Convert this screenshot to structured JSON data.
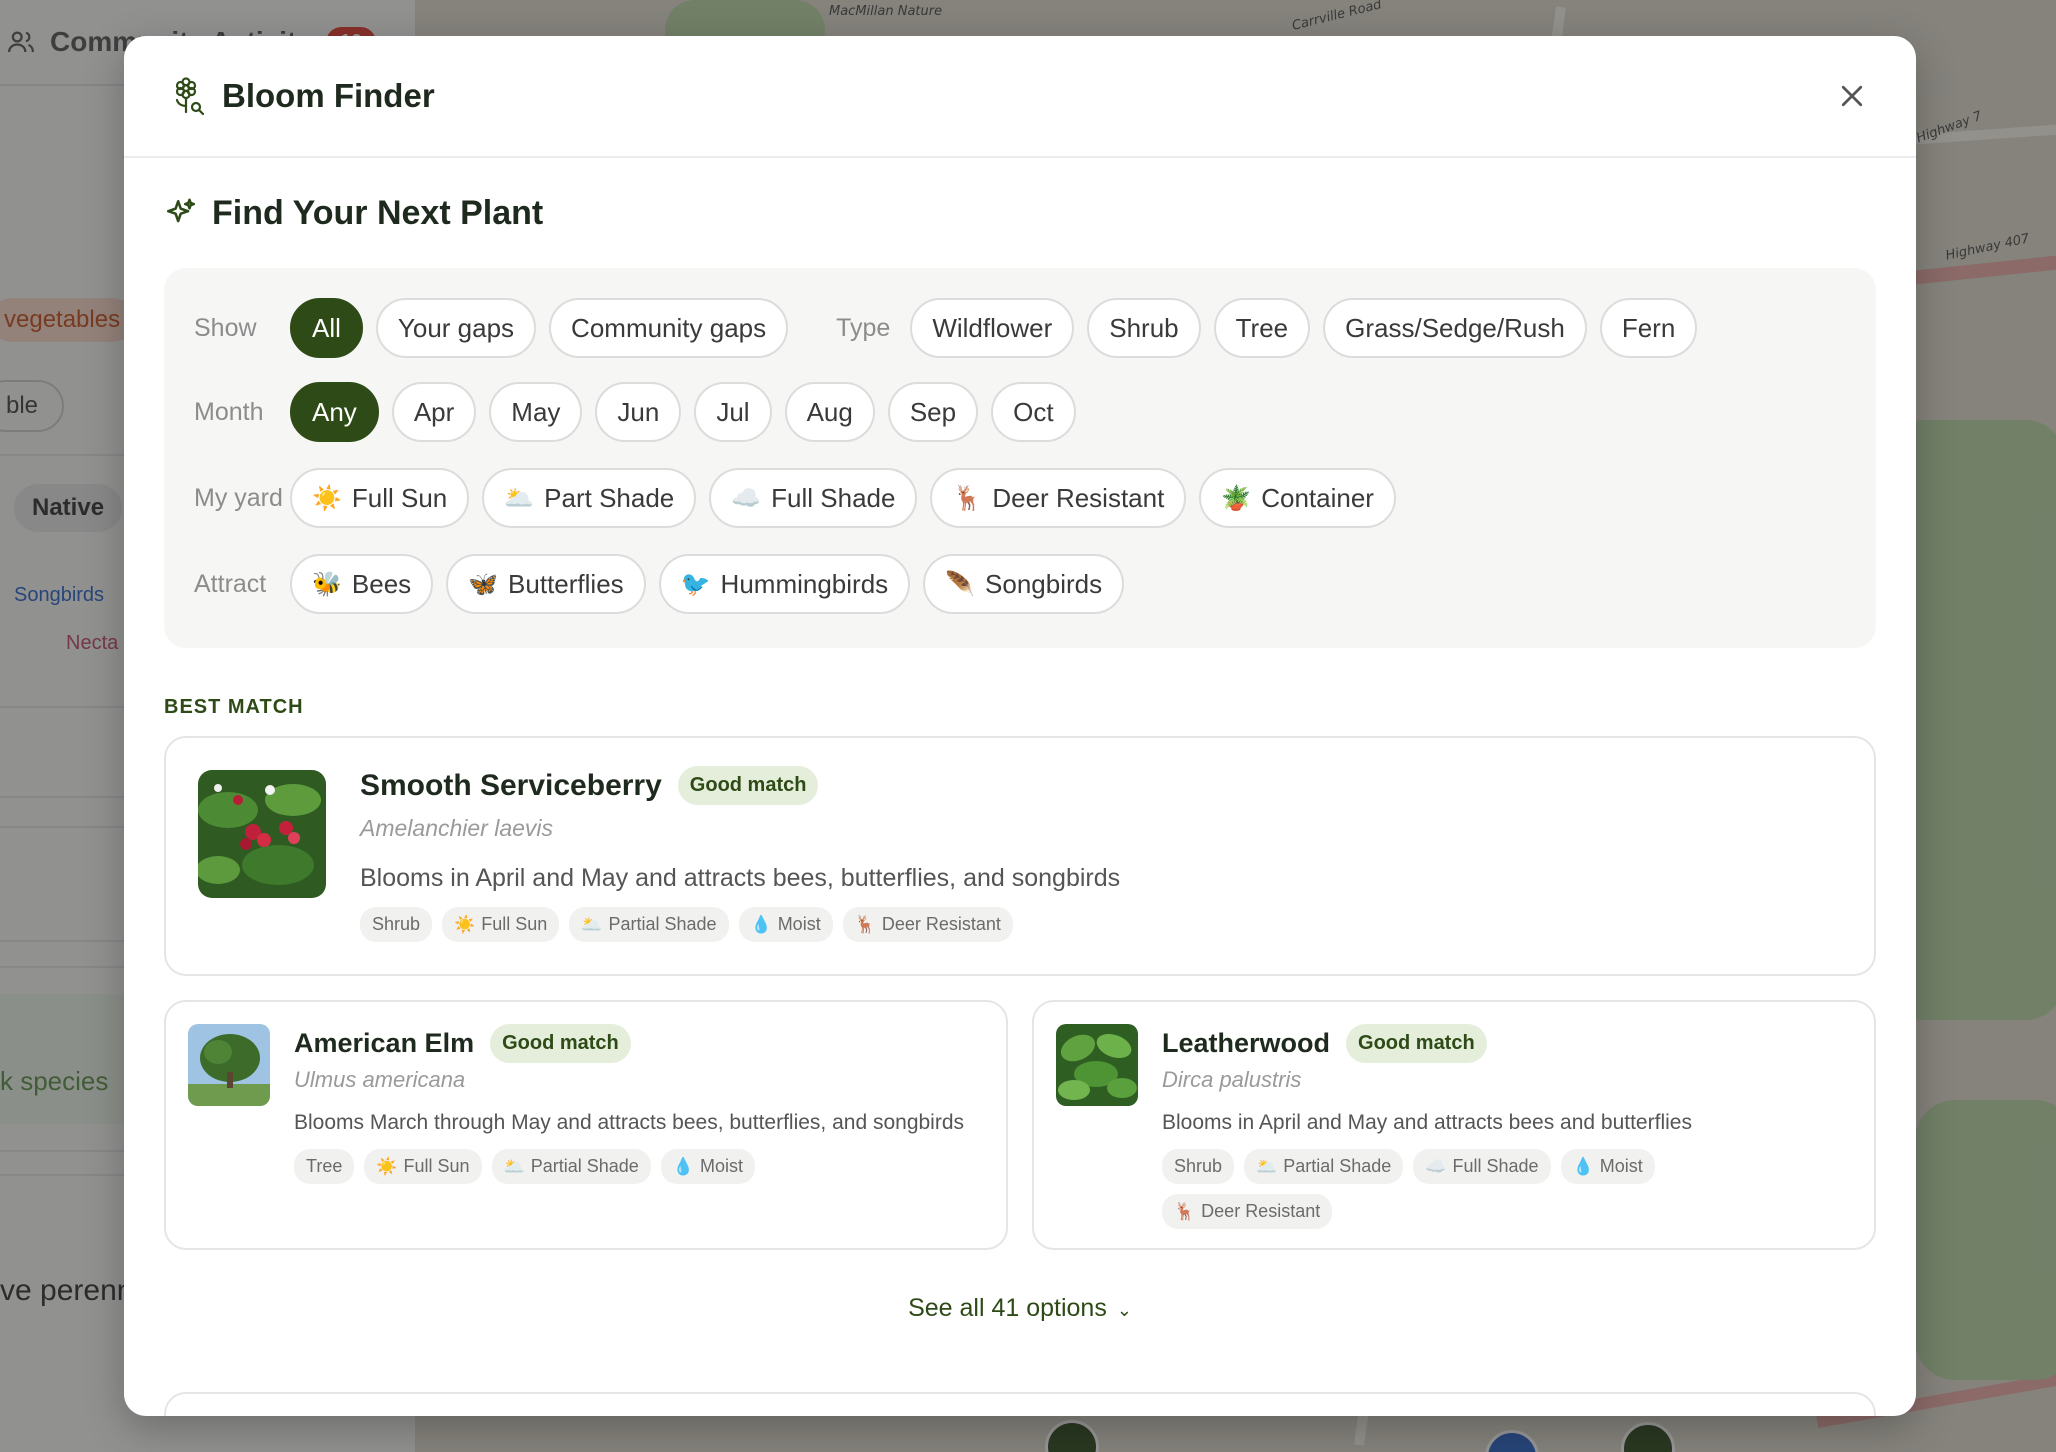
{
  "background": {
    "header_title": "Community Activity",
    "header_badge": "10",
    "chip_vegetables": "vegetables",
    "chip_partial": "ble",
    "chip_native": "Native",
    "tag_songbirds": "Songbirds",
    "tag_nectar": "Necta",
    "link_species": "k species",
    "text_perennial": "ve perenn",
    "map_labels": [
      "MacMillan Nature",
      "Carrville Road",
      "Highway 7",
      "Highway 407"
    ]
  },
  "modal": {
    "title": "Bloom Finder",
    "section_title": "Find Your Next Plant",
    "filters": {
      "show_label": "Show",
      "show_options": [
        "All",
        "Your gaps",
        "Community gaps"
      ],
      "show_active": "All",
      "type_label": "Type",
      "type_options": [
        "Wildflower",
        "Shrub",
        "Tree",
        "Grass/Sedge/Rush",
        "Fern"
      ],
      "month_label": "Month",
      "month_options": [
        "Any",
        "Apr",
        "May",
        "Jun",
        "Jul",
        "Aug",
        "Sep",
        "Oct"
      ],
      "month_active": "Any",
      "yard_label": "My yard",
      "yard_options": [
        {
          "emoji": "☀️",
          "label": "Full Sun"
        },
        {
          "emoji": "🌥️",
          "label": "Part Shade"
        },
        {
          "emoji": "☁️",
          "label": "Full Shade"
        },
        {
          "emoji": "🦌",
          "label": "Deer Resistant"
        },
        {
          "emoji": "🪴",
          "label": "Container"
        }
      ],
      "attract_label": "Attract",
      "attract_options": [
        {
          "emoji": "🐝",
          "label": "Bees"
        },
        {
          "emoji": "🦋",
          "label": "Butterflies"
        },
        {
          "emoji": "🐦",
          "label": "Hummingbirds"
        },
        {
          "emoji": "🪶",
          "label": "Songbirds"
        }
      ]
    },
    "best_match_label": "BEST MATCH",
    "results": [
      {
        "name": "Smooth Serviceberry",
        "match": "Good match",
        "scientific": "Amelanchier laevis",
        "description": "Blooms in April and May and attracts bees, butterflies, and songbirds",
        "tags": [
          {
            "emoji": "",
            "label": "Shrub"
          },
          {
            "emoji": "☀️",
            "label": "Full Sun"
          },
          {
            "emoji": "🌥️",
            "label": "Partial Shade"
          },
          {
            "emoji": "💧",
            "label": "Moist"
          },
          {
            "emoji": "🦌",
            "label": "Deer Resistant"
          }
        ]
      },
      {
        "name": "American Elm",
        "match": "Good match",
        "scientific": "Ulmus americana",
        "description": "Blooms March through May and attracts bees, butterflies, and songbirds",
        "tags": [
          {
            "emoji": "",
            "label": "Tree"
          },
          {
            "emoji": "☀️",
            "label": "Full Sun"
          },
          {
            "emoji": "🌥️",
            "label": "Partial Shade"
          },
          {
            "emoji": "💧",
            "label": "Moist"
          }
        ]
      },
      {
        "name": "Leatherwood",
        "match": "Good match",
        "scientific": "Dirca palustris",
        "description": "Blooms in April and May and attracts bees and butterflies",
        "tags": [
          {
            "emoji": "",
            "label": "Shrub"
          },
          {
            "emoji": "🌥️",
            "label": "Partial Shade"
          },
          {
            "emoji": "☁️",
            "label": "Full Shade"
          },
          {
            "emoji": "💧",
            "label": "Moist"
          },
          {
            "emoji": "🦌",
            "label": "Deer Resistant"
          }
        ]
      }
    ],
    "see_all": "See all 41 options"
  },
  "colors": {
    "accent": "#2e4b17",
    "match_bg": "#e5eedb",
    "chip_border": "#dcdcdc",
    "filter_panel": "#f6f6f5"
  }
}
